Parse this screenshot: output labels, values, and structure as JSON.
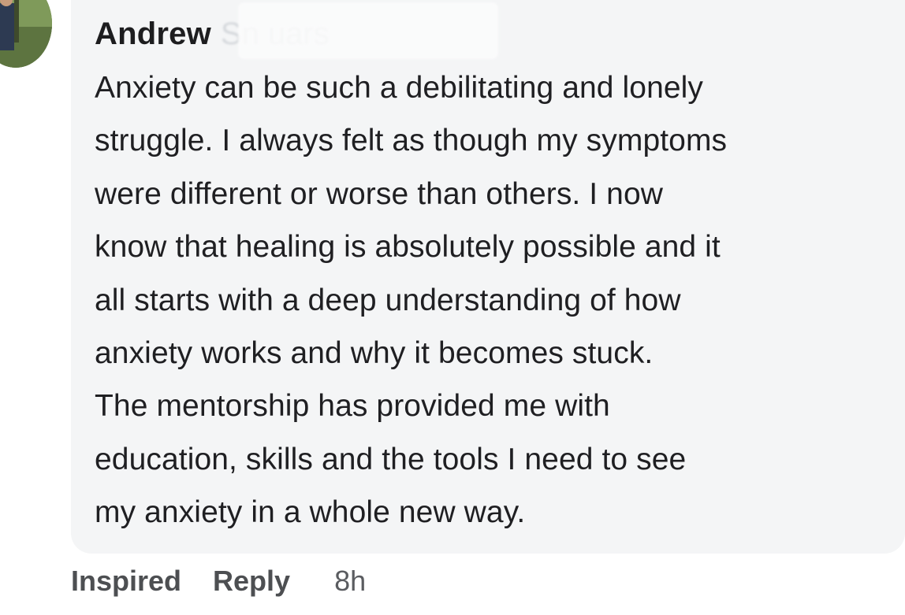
{
  "comment": {
    "author_first": "Andrew",
    "author_last_obscured": "Sn         uars",
    "lines": [
      "Anxiety can be such a debilitating and lonely",
      "struggle. I always felt as though my symptoms",
      "were different or worse than others. I now",
      "know that healing is absolutely possible and it",
      "all starts with a deep understanding of how",
      "anxiety works and why it becomes stuck.",
      "The mentorship has provided me with",
      "education, skills and the tools I need to see",
      "my anxiety in a whole new way."
    ],
    "avatar_icon": "user-avatar-photo"
  },
  "actions": {
    "inspired_label": "Inspired",
    "reply_label": "Reply",
    "timestamp": "8h"
  },
  "colors": {
    "bubble_background": "#f4f5f6",
    "text": "#1f1f22",
    "action_text": "#4d4f52"
  }
}
